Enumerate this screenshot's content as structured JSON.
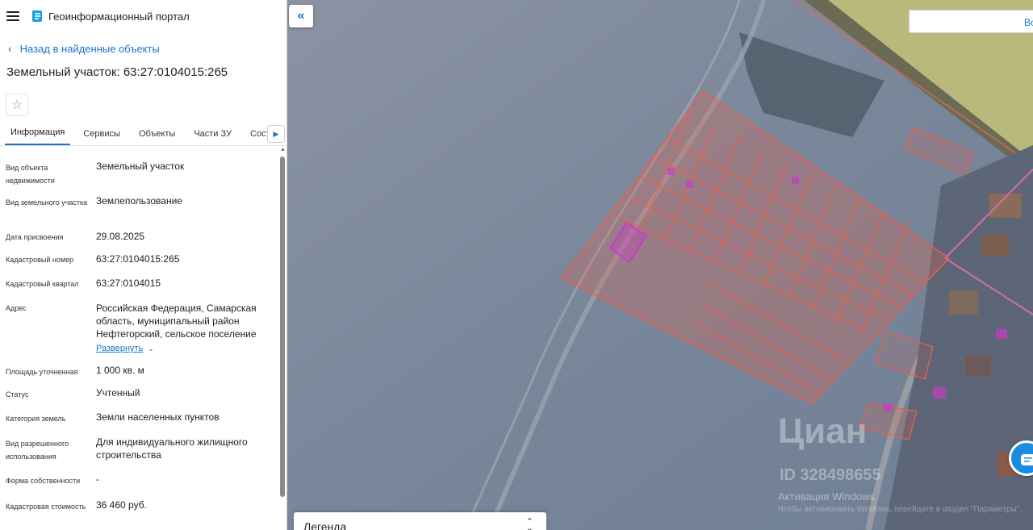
{
  "header": {
    "title": "Геоинформационный портал"
  },
  "nav": {
    "back_label": "Назад в найденные объекты"
  },
  "object": {
    "title": "Земельный участок: 63:27:0104015:265"
  },
  "tabs": [
    {
      "label": "Информация",
      "active": true
    },
    {
      "label": "Сервисы"
    },
    {
      "label": "Объекты"
    },
    {
      "label": "Части ЗУ"
    },
    {
      "label": "Состав"
    }
  ],
  "properties": [
    {
      "label": "Вид объекта недвижимости",
      "value": "Земельный участок"
    },
    {
      "label": "Вид земельного участка",
      "value": "Землепользование"
    },
    {
      "label": "Дата присвоения",
      "value": "29.08.2025"
    },
    {
      "label": "Кадастровый номер",
      "value": "63:27:0104015:265"
    },
    {
      "label": "Кадастровый квартал",
      "value": "63:27:0104015"
    },
    {
      "label": "Адрес",
      "value": "Российская Федерация, Самарская область, муниципальный район Нефтегорский, сельское поселение",
      "expand_label": "Развернуть"
    },
    {
      "label": "Площадь уточненная",
      "value": "1 000 кв. м"
    },
    {
      "label": "Статус",
      "value": "Учтенный"
    },
    {
      "label": "Категория земель",
      "value": "Земли населенных пунктов"
    },
    {
      "label": "Вид разрешенного использования",
      "value": "Для индивидуального жилищного строительства"
    },
    {
      "label": "Форма собственности",
      "value": "-"
    },
    {
      "label": "Кадастровая стоимость",
      "value": "36 460 руб."
    }
  ],
  "map": {
    "search_text": "Во",
    "legend_label": "Легенда",
    "watermark": "Циан",
    "watermark_id": "ID 328498655",
    "activation_title": "Активация Windows",
    "activation_text": "Чтобы активировать Windows, перейдите в раздел \"Параметры\".",
    "colors": {
      "parcel": "#e8604c",
      "selected": "#c83cc8",
      "accent": "#1a73c8"
    }
  },
  "icons": {
    "menu": "hamburger-icon",
    "logo": "portal-logo-icon",
    "back": "chevron-left-icon",
    "favorite": "star-icon",
    "collapse": "double-chevron-left-icon",
    "chat": "chat-icon"
  }
}
